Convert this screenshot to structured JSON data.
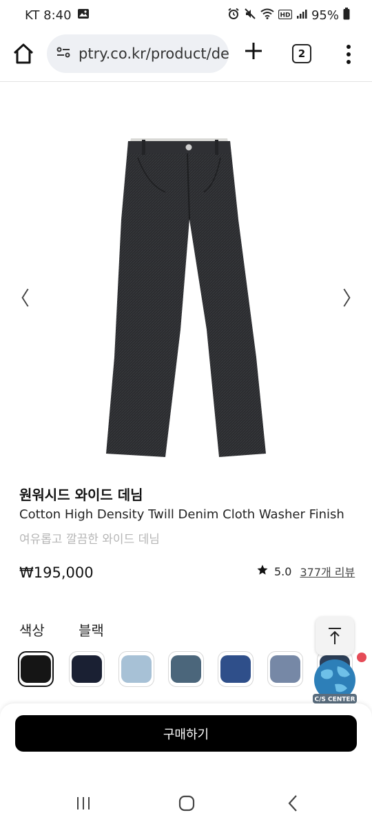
{
  "status_bar": {
    "carrier_time": "KT 8:40",
    "battery": "95%"
  },
  "browser": {
    "url": "ptry.co.kr/product/de",
    "tab_count": "2"
  },
  "product": {
    "title": "원워시드 와이드 데님",
    "subtitle": "Cotton High Density Twill Denim Cloth Washer Finish",
    "description": "여유롭고 깔끔한 와이드 데님",
    "price": "₩195,000",
    "rating": "5.0",
    "reviews": "377개 리뷰"
  },
  "options": {
    "color_label": "색상",
    "color_value": "블랙",
    "swatch_colors": [
      "#151515",
      "#1a2033",
      "#a7c1d6",
      "#4b667b",
      "#2f4f8a",
      "#7688a6",
      "#2c3f58"
    ]
  },
  "cs_center": {
    "label": "C/S CENTER"
  },
  "purchase": {
    "button_label": "구매하기"
  },
  "colors": {
    "accent": "#000000",
    "notification": "#e54b57"
  }
}
